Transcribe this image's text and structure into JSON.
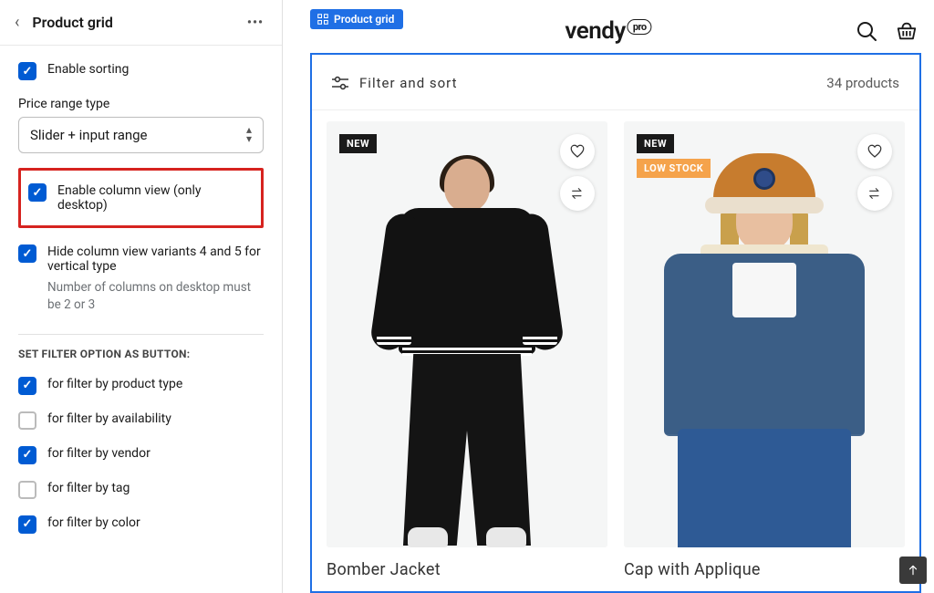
{
  "sidebar": {
    "title": "Product grid",
    "enable_sorting": "Enable sorting",
    "price_range_label": "Price range type",
    "price_range_value": "Slider + input range",
    "enable_column_view": "Enable column view (only desktop)",
    "hide_variants": "Hide column view variants 4 and 5 for vertical type",
    "hide_variants_help": "Number of columns on desktop must be 2 or 3",
    "section_label": "SET FILTER OPTION AS BUTTON:",
    "filters": {
      "product_type": "for filter by product type",
      "availability": "for filter by availability",
      "vendor": "for filter by vendor",
      "tag": "for filter by tag",
      "color": "for filter by color"
    }
  },
  "preview": {
    "section_tag": "Product grid",
    "brand": "vendy",
    "brand_suffix": "pro",
    "filter_sort": "Filter and sort",
    "count": "34 products",
    "cards": {
      "card1": {
        "new": "NEW",
        "title": "Bomber Jacket"
      },
      "card2": {
        "new": "NEW",
        "low": "LOW STOCK",
        "title": "Cap with Applique"
      }
    }
  }
}
